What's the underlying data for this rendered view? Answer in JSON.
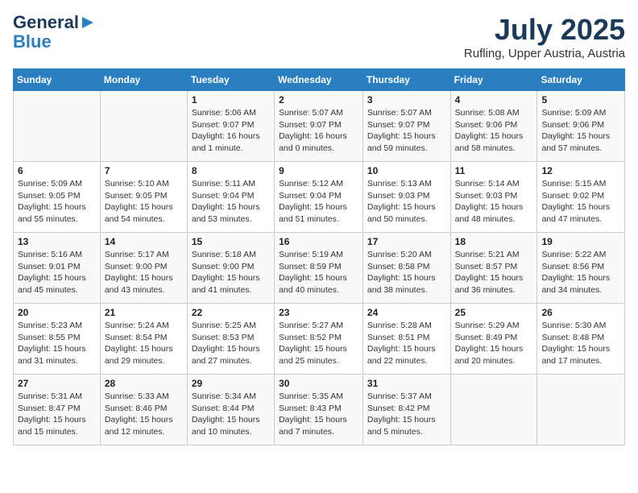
{
  "header": {
    "logo_line1": "General",
    "logo_line2": "Blue",
    "month_title": "July 2025",
    "location": "Rufling, Upper Austria, Austria"
  },
  "weekdays": [
    "Sunday",
    "Monday",
    "Tuesday",
    "Wednesday",
    "Thursday",
    "Friday",
    "Saturday"
  ],
  "weeks": [
    [
      {
        "day": "",
        "info": ""
      },
      {
        "day": "",
        "info": ""
      },
      {
        "day": "1",
        "info": "Sunrise: 5:06 AM\nSunset: 9:07 PM\nDaylight: 16 hours\nand 1 minute."
      },
      {
        "day": "2",
        "info": "Sunrise: 5:07 AM\nSunset: 9:07 PM\nDaylight: 16 hours\nand 0 minutes."
      },
      {
        "day": "3",
        "info": "Sunrise: 5:07 AM\nSunset: 9:07 PM\nDaylight: 15 hours\nand 59 minutes."
      },
      {
        "day": "4",
        "info": "Sunrise: 5:08 AM\nSunset: 9:06 PM\nDaylight: 15 hours\nand 58 minutes."
      },
      {
        "day": "5",
        "info": "Sunrise: 5:09 AM\nSunset: 9:06 PM\nDaylight: 15 hours\nand 57 minutes."
      }
    ],
    [
      {
        "day": "6",
        "info": "Sunrise: 5:09 AM\nSunset: 9:05 PM\nDaylight: 15 hours\nand 55 minutes."
      },
      {
        "day": "7",
        "info": "Sunrise: 5:10 AM\nSunset: 9:05 PM\nDaylight: 15 hours\nand 54 minutes."
      },
      {
        "day": "8",
        "info": "Sunrise: 5:11 AM\nSunset: 9:04 PM\nDaylight: 15 hours\nand 53 minutes."
      },
      {
        "day": "9",
        "info": "Sunrise: 5:12 AM\nSunset: 9:04 PM\nDaylight: 15 hours\nand 51 minutes."
      },
      {
        "day": "10",
        "info": "Sunrise: 5:13 AM\nSunset: 9:03 PM\nDaylight: 15 hours\nand 50 minutes."
      },
      {
        "day": "11",
        "info": "Sunrise: 5:14 AM\nSunset: 9:03 PM\nDaylight: 15 hours\nand 48 minutes."
      },
      {
        "day": "12",
        "info": "Sunrise: 5:15 AM\nSunset: 9:02 PM\nDaylight: 15 hours\nand 47 minutes."
      }
    ],
    [
      {
        "day": "13",
        "info": "Sunrise: 5:16 AM\nSunset: 9:01 PM\nDaylight: 15 hours\nand 45 minutes."
      },
      {
        "day": "14",
        "info": "Sunrise: 5:17 AM\nSunset: 9:00 PM\nDaylight: 15 hours\nand 43 minutes."
      },
      {
        "day": "15",
        "info": "Sunrise: 5:18 AM\nSunset: 9:00 PM\nDaylight: 15 hours\nand 41 minutes."
      },
      {
        "day": "16",
        "info": "Sunrise: 5:19 AM\nSunset: 8:59 PM\nDaylight: 15 hours\nand 40 minutes."
      },
      {
        "day": "17",
        "info": "Sunrise: 5:20 AM\nSunset: 8:58 PM\nDaylight: 15 hours\nand 38 minutes."
      },
      {
        "day": "18",
        "info": "Sunrise: 5:21 AM\nSunset: 8:57 PM\nDaylight: 15 hours\nand 36 minutes."
      },
      {
        "day": "19",
        "info": "Sunrise: 5:22 AM\nSunset: 8:56 PM\nDaylight: 15 hours\nand 34 minutes."
      }
    ],
    [
      {
        "day": "20",
        "info": "Sunrise: 5:23 AM\nSunset: 8:55 PM\nDaylight: 15 hours\nand 31 minutes."
      },
      {
        "day": "21",
        "info": "Sunrise: 5:24 AM\nSunset: 8:54 PM\nDaylight: 15 hours\nand 29 minutes."
      },
      {
        "day": "22",
        "info": "Sunrise: 5:25 AM\nSunset: 8:53 PM\nDaylight: 15 hours\nand 27 minutes."
      },
      {
        "day": "23",
        "info": "Sunrise: 5:27 AM\nSunset: 8:52 PM\nDaylight: 15 hours\nand 25 minutes."
      },
      {
        "day": "24",
        "info": "Sunrise: 5:28 AM\nSunset: 8:51 PM\nDaylight: 15 hours\nand 22 minutes."
      },
      {
        "day": "25",
        "info": "Sunrise: 5:29 AM\nSunset: 8:49 PM\nDaylight: 15 hours\nand 20 minutes."
      },
      {
        "day": "26",
        "info": "Sunrise: 5:30 AM\nSunset: 8:48 PM\nDaylight: 15 hours\nand 17 minutes."
      }
    ],
    [
      {
        "day": "27",
        "info": "Sunrise: 5:31 AM\nSunset: 8:47 PM\nDaylight: 15 hours\nand 15 minutes."
      },
      {
        "day": "28",
        "info": "Sunrise: 5:33 AM\nSunset: 8:46 PM\nDaylight: 15 hours\nand 12 minutes."
      },
      {
        "day": "29",
        "info": "Sunrise: 5:34 AM\nSunset: 8:44 PM\nDaylight: 15 hours\nand 10 minutes."
      },
      {
        "day": "30",
        "info": "Sunrise: 5:35 AM\nSunset: 8:43 PM\nDaylight: 15 hours\nand 7 minutes."
      },
      {
        "day": "31",
        "info": "Sunrise: 5:37 AM\nSunset: 8:42 PM\nDaylight: 15 hours\nand 5 minutes."
      },
      {
        "day": "",
        "info": ""
      },
      {
        "day": "",
        "info": ""
      }
    ]
  ]
}
